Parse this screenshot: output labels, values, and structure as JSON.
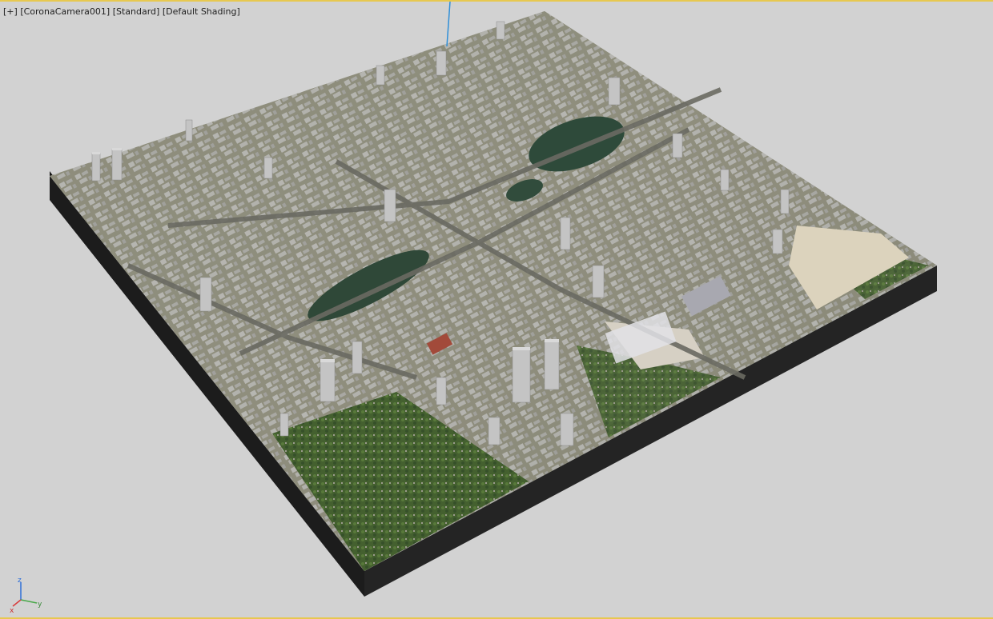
{
  "viewport": {
    "menu_plus": "[+]",
    "camera": "[CoronaCamera001]",
    "mode": "[Standard]",
    "shading": "[Default Shading]"
  },
  "axis": {
    "x": "x",
    "y": "y",
    "z": "z"
  },
  "colors": {
    "background": "#d2d2d2",
    "viewport_border": "#e7c850",
    "slab_side_dark": "#141414",
    "slab_side_light": "#2a2a2a",
    "terrain_base": "#8a8a78",
    "water": "#2f4a3a",
    "forest": "#3f5a32",
    "sand": "#d8cfb8",
    "building": "#b9b9b9",
    "z_axis_line": "#2f8fd8"
  },
  "icons": {
    "axis_gizmo": "axis-tripod-icon"
  }
}
